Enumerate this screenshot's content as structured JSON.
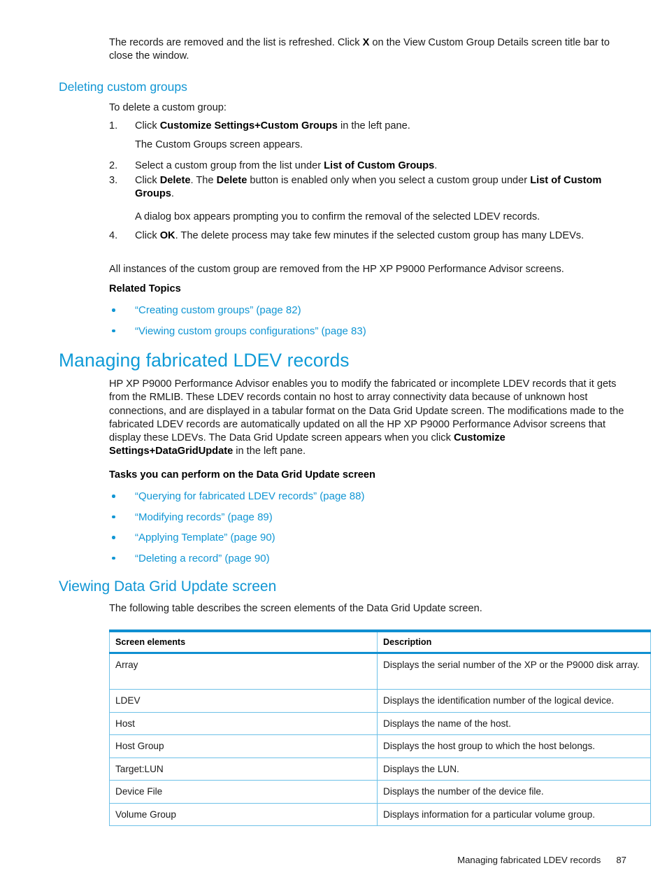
{
  "intro": {
    "para1_a": "The records are removed and the list is refreshed. Click ",
    "para1_b": "X",
    "para1_c": " on the View Custom Group Details screen title bar to close the window."
  },
  "deleting_section": {
    "heading": "Deleting custom groups",
    "lead": "To delete a custom group:",
    "steps": [
      {
        "num": "1.",
        "a": "Click ",
        "b": "Customize Settings+Custom Groups",
        "c": " in the left pane.",
        "note": "The Custom Groups screen appears."
      },
      {
        "num": "2.",
        "a": "Select a custom group from the list under ",
        "b": "List of Custom Groups",
        "c": "."
      },
      {
        "num": "3.",
        "a": "Click ",
        "b": "Delete",
        "c": ". The ",
        "d": "Delete",
        "e": " button is enabled only when you select a custom group under ",
        "f": "List of Custom Groups",
        "g": ".",
        "note": "A dialog box appears prompting you to confirm the removal of the selected LDEV records."
      },
      {
        "num": "4.",
        "a": "Click ",
        "b": "OK",
        "c": ". The delete process may take few minutes if the selected custom group has many LDEVs."
      }
    ],
    "closing": "All instances of the custom group are removed from the HP XP P9000 Performance Advisor screens.",
    "related_heading": "Related Topics",
    "related_links": [
      "“Creating custom groups” (page 82)",
      "“Viewing custom groups configurations” (page 83)"
    ]
  },
  "managing_section": {
    "heading": "Managing fabricated LDEV records",
    "para_a": "HP XP P9000 Performance Advisor enables you to modify the fabricated or incomplete LDEV records that it gets from the RMLIB. These LDEV records contain no host to array connectivity data because of unknown host connections, and are displayed in a tabular format on the Data Grid Update screen. The modifications made to the fabricated LDEV records are automatically updated on all the HP XP P9000 Performance Advisor screens that display these LDEVs. The Data Grid Update screen appears when you click ",
    "para_b": "Customize Settings+DataGridUpdate",
    "para_c": " in the left pane.",
    "tasks_heading": "Tasks you can perform on the Data Grid Update screen",
    "task_links": [
      "“Querying for fabricated LDEV records” (page 88)",
      "“Modifying records” (page 89)",
      "“Applying Template” (page 90)",
      "“Deleting a record” (page 90)"
    ]
  },
  "viewing_section": {
    "heading": "Viewing Data Grid Update screen",
    "lead": "The following table describes the screen elements of the Data Grid Update screen.",
    "table": {
      "headers": [
        "Screen elements",
        "Description"
      ],
      "rows": [
        [
          "Array",
          "Displays the serial number of the XP or the P9000 disk array."
        ],
        [
          "LDEV",
          "Displays the identification number of the logical device."
        ],
        [
          "Host",
          "Displays the name of the host."
        ],
        [
          "Host Group",
          "Displays the host group to which the host belongs."
        ],
        [
          "Target:LUN",
          "Displays the LUN."
        ],
        [
          "Device File",
          "Displays the number of the device file."
        ],
        [
          "Volume Group",
          "Displays information for a particular volume group."
        ]
      ]
    }
  },
  "footer": {
    "title": "Managing fabricated LDEV records",
    "page_number": "87"
  },
  "colors": {
    "heading_blue": "#0f9bd7",
    "link_blue": "#1196d4",
    "table_header_rule": "#0f8fd1",
    "table_border": "#6ec1e8"
  }
}
